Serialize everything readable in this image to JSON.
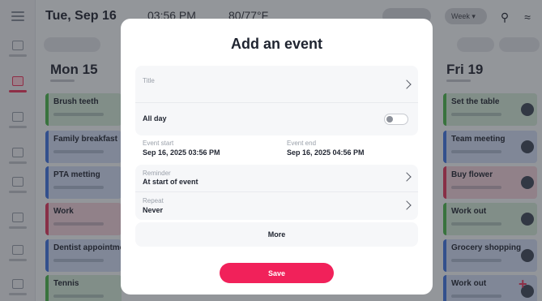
{
  "header": {
    "date": "Tue, Sep 16",
    "time": "03:56 PM",
    "weather": "80/77°F",
    "view_select": "Week",
    "search_icon": "search-icon",
    "wifi_icon": "wifi-icon"
  },
  "days": [
    {
      "name": "Mon 15",
      "events": [
        {
          "title": "Brush teeth",
          "color": "#48b04a"
        },
        {
          "title": "Family breakfast",
          "color": "#3c6fd9"
        },
        {
          "title": "PTA metting",
          "color": "#3c6fd9"
        },
        {
          "title": "Work",
          "color": "#d7365a"
        },
        {
          "title": "Dentist appointmen",
          "color": "#3c6fd9"
        },
        {
          "title": "Tennis",
          "color": "#48b04a"
        }
      ]
    },
    {
      "name": "Fri 19",
      "events": [
        {
          "title": "Set the table",
          "color": "#48b04a"
        },
        {
          "title": "Team meeting",
          "color": "#3c6fd9"
        },
        {
          "title": "Buy flower",
          "color": "#d7365a"
        },
        {
          "title": "Work out",
          "color": "#48b04a"
        },
        {
          "title": "Grocery shopping",
          "color": "#3c6fd9"
        },
        {
          "title": "Work out",
          "color": "#3c6fd9"
        }
      ]
    }
  ],
  "modal": {
    "title": "Add an event",
    "title_field": {
      "label": "Title",
      "value": ""
    },
    "all_day": {
      "label": "All day",
      "on": false
    },
    "event_start": {
      "label": "Event start",
      "value": "Sep 16, 2025 03:56 PM"
    },
    "event_end": {
      "label": "Event end",
      "value": "Sep 16, 2025 04:56 PM"
    },
    "reminder": {
      "label": "Reminder",
      "value": "At start of event"
    },
    "repeat": {
      "label": "Repeat",
      "value": "Never"
    },
    "more_label": "More",
    "save_label": "Save"
  },
  "colors": {
    "accent": "#f1215a",
    "green": "#48b04a",
    "blue": "#3c6fd9",
    "red": "#d7365a"
  }
}
